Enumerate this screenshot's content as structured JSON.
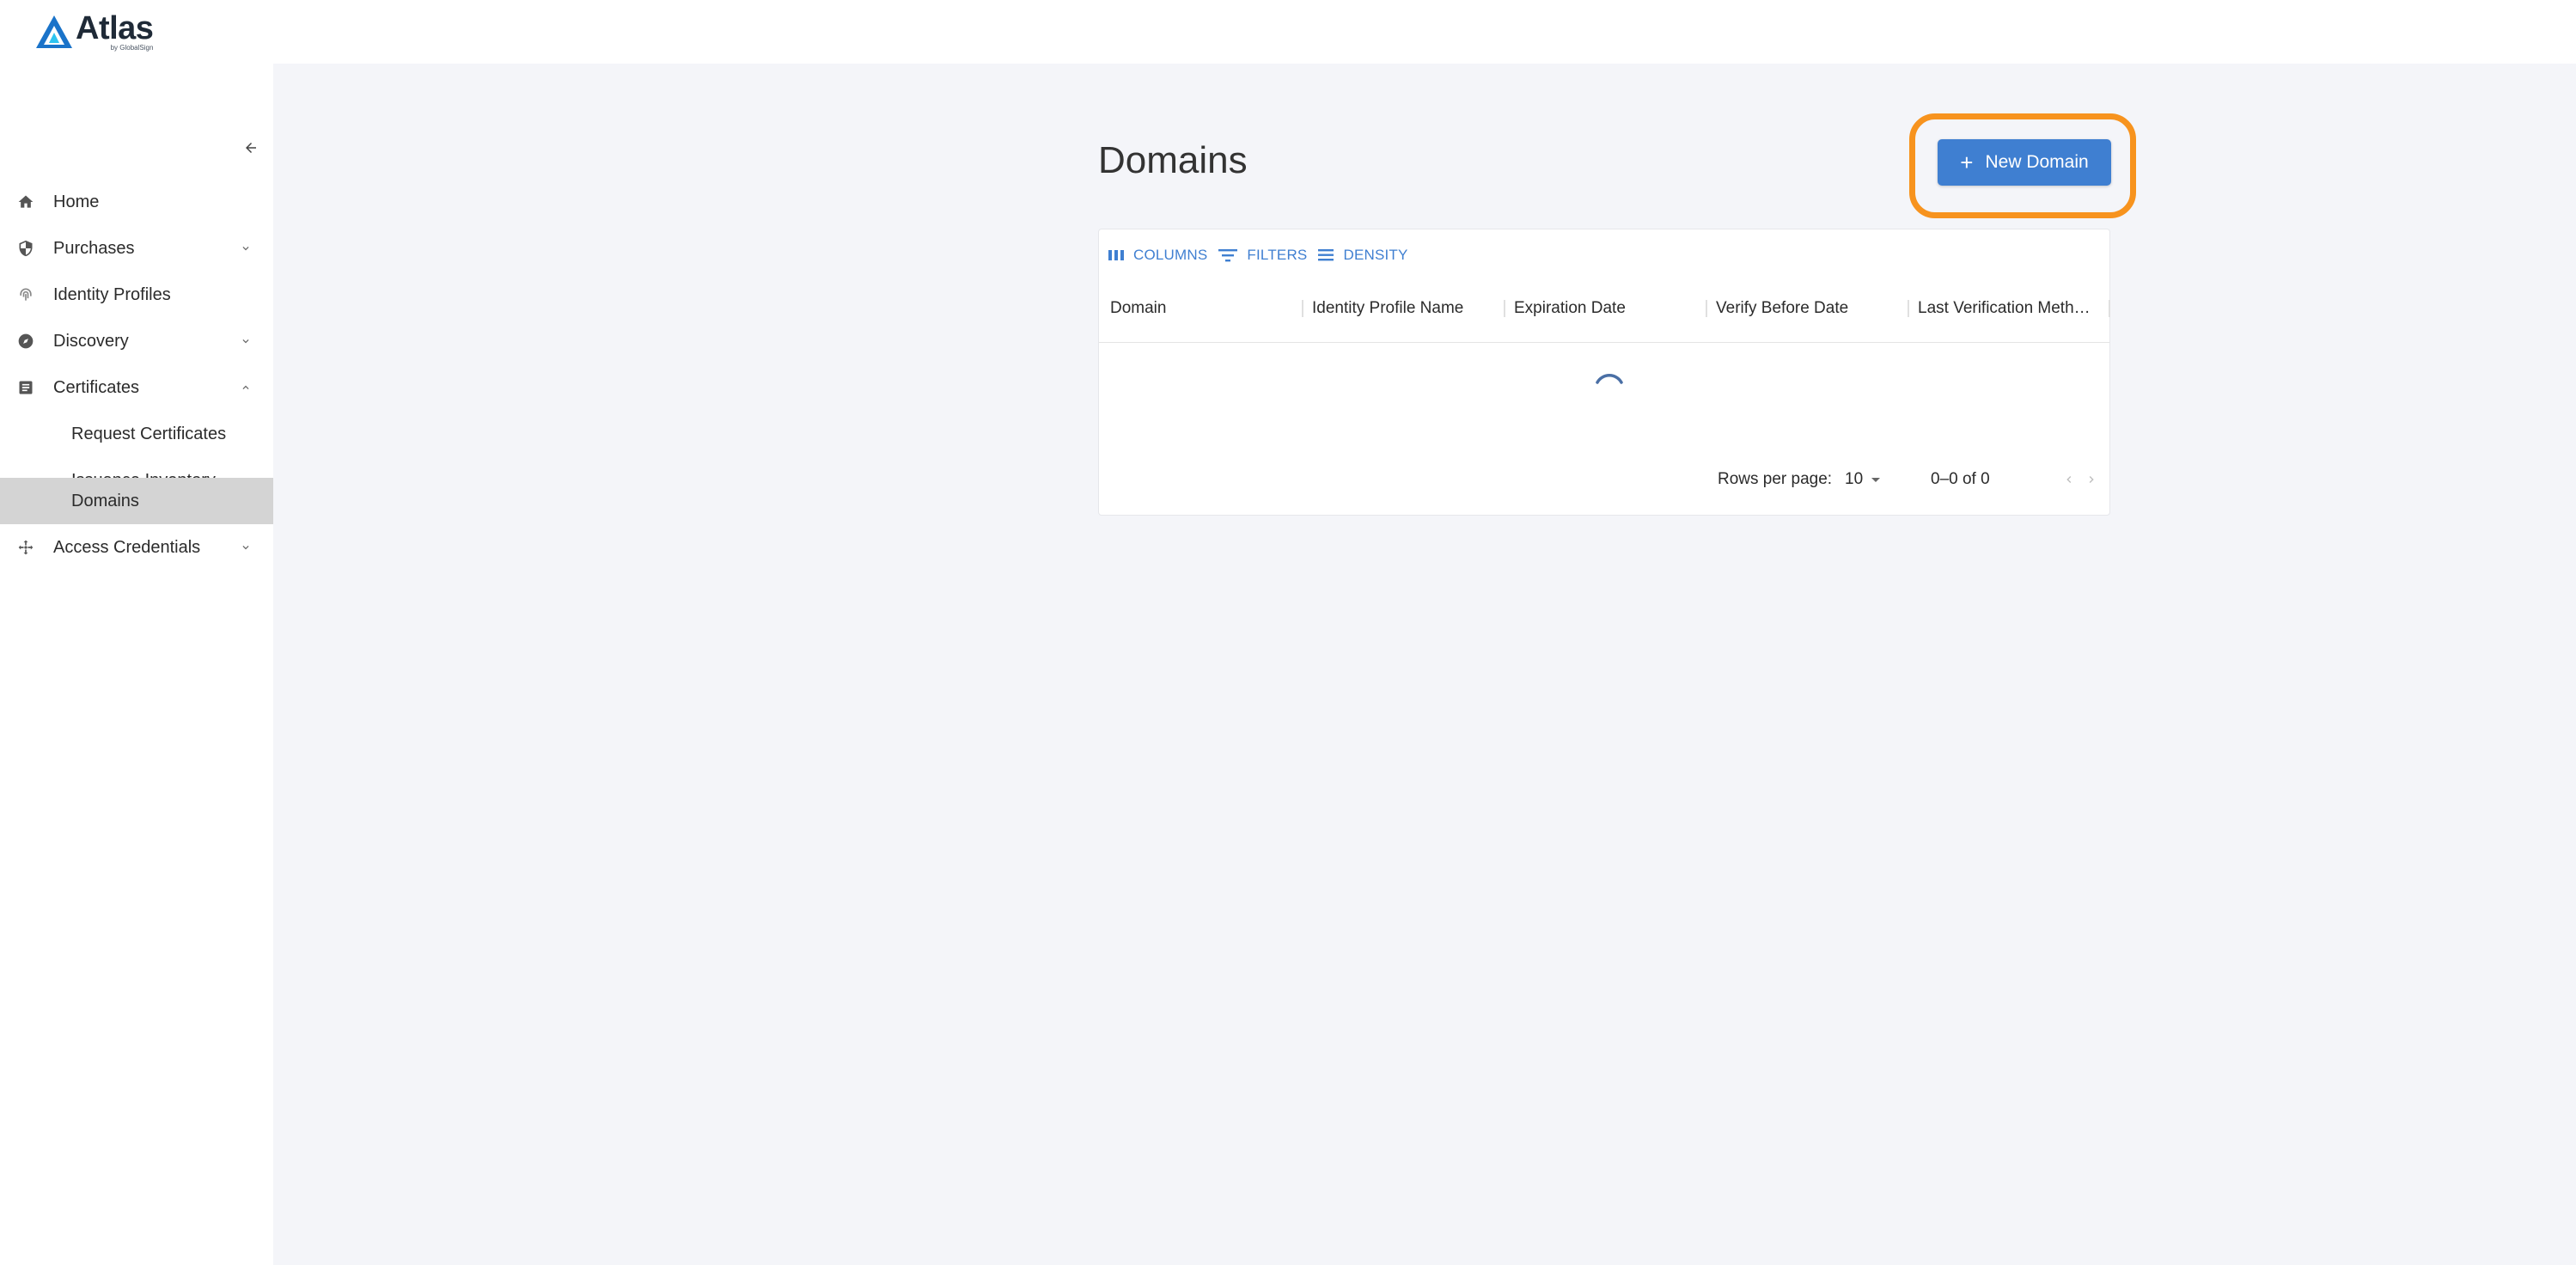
{
  "app": {
    "brand": "Atlas",
    "brand_sub": "by GlobalSign"
  },
  "sidebar": {
    "items": [
      {
        "label": "Home",
        "icon": "home-icon"
      },
      {
        "label": "Purchases",
        "icon": "shield-icon",
        "expandable": true,
        "expanded": false
      },
      {
        "label": "Identity Profiles",
        "icon": "fingerprint-icon"
      },
      {
        "label": "Discovery",
        "icon": "compass-icon",
        "expandable": true,
        "expanded": false
      },
      {
        "label": "Certificates",
        "icon": "document-icon",
        "expandable": true,
        "expanded": true,
        "children": [
          {
            "label": "Request Certificates"
          },
          {
            "label": "Issuance Inventory"
          },
          {
            "label": "Domains",
            "active": true
          }
        ]
      },
      {
        "label": "Access Credentials",
        "icon": "arrows-icon",
        "expandable": true,
        "expanded": false
      }
    ]
  },
  "main": {
    "title": "Domains",
    "new_button_label": "New Domain",
    "toolbar": {
      "columns": "COLUMNS",
      "filters": "FILTERS",
      "density": "DENSITY"
    },
    "columns": [
      "Domain",
      "Identity Profile Name",
      "Expiration Date",
      "Verify Before Date",
      "Last Verification Meth…"
    ],
    "loading": true,
    "footer": {
      "rows_per_page_label": "Rows per page:",
      "rows_per_page_value": "10",
      "range": "0–0 of 0"
    }
  },
  "colors": {
    "accent": "#3f7fd1",
    "highlight": "#f7931e",
    "active_nav": "#d4d4d4",
    "main_bg": "#f4f5f9"
  }
}
